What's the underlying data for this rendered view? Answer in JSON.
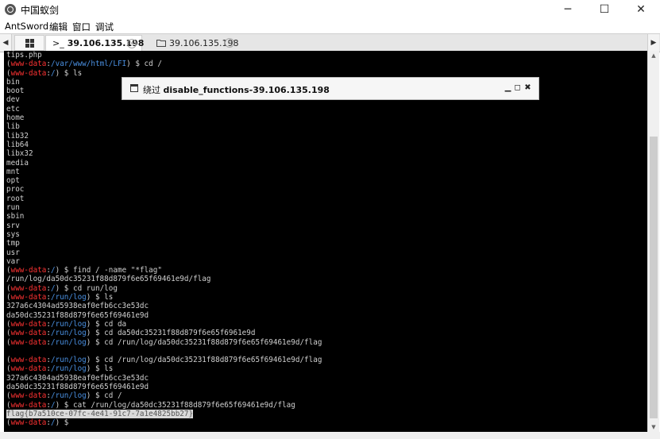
{
  "window": {
    "title": "中国蚁剑",
    "minimize": "─",
    "maximize": "☐",
    "close": "✕"
  },
  "menu": [
    "AntSword",
    "编辑",
    "窗口",
    "调试"
  ],
  "tabs": {
    "prev": "◀",
    "next": "▶",
    "active": {
      "prefix": ">_",
      "label": "39.106.135.198"
    },
    "inactive": {
      "label": "39.106.135.198"
    }
  },
  "dialog": {
    "prefix": "绕过",
    "title": "disable_functions-39.106.135.198",
    "minimize": "▁",
    "maximize": "◻",
    "close": "✖"
  },
  "terminal": {
    "lines": [
      {
        "t": "tips.php"
      },
      {
        "p": {
          "user": "www-data",
          "path": "/var/www/html/LFI"
        },
        "c": "cd /"
      },
      {
        "p": {
          "user": "www-data",
          "path": "/"
        },
        "c": "ls"
      },
      {
        "t": "bin"
      },
      {
        "t": "boot"
      },
      {
        "t": "dev"
      },
      {
        "t": "etc"
      },
      {
        "t": "home"
      },
      {
        "t": "lib"
      },
      {
        "t": "lib32"
      },
      {
        "t": "lib64"
      },
      {
        "t": "libx32"
      },
      {
        "t": "media"
      },
      {
        "t": "mnt"
      },
      {
        "t": "opt"
      },
      {
        "t": "proc"
      },
      {
        "t": "root"
      },
      {
        "t": "run"
      },
      {
        "t": "sbin"
      },
      {
        "t": "srv"
      },
      {
        "t": "sys"
      },
      {
        "t": "tmp"
      },
      {
        "t": "usr"
      },
      {
        "t": "var"
      },
      {
        "p": {
          "user": "www-data",
          "path": "/"
        },
        "c": "find / -name \"*flag\""
      },
      {
        "t": "/run/log/da50dc35231f88d879f6e65f69461e9d/flag"
      },
      {
        "p": {
          "user": "www-data",
          "path": "/"
        },
        "c": "cd run/log"
      },
      {
        "p": {
          "user": "www-data",
          "path": "/run/log"
        },
        "c": "ls"
      },
      {
        "t": "327a6c4304ad5938eaf0efb6cc3e53dc"
      },
      {
        "t": "da50dc35231f88d879f6e65f69461e9d"
      },
      {
        "p": {
          "user": "www-data",
          "path": "/run/log"
        },
        "c": "cd da"
      },
      {
        "p": {
          "user": "www-data",
          "path": "/run/log"
        },
        "c": "cd da50dc35231f88d879f6e65f6961e9d"
      },
      {
        "p": {
          "user": "www-data",
          "path": "/run/log"
        },
        "c": "cd /run/log/da50dc35231f88d879f6e65f69461e9d/flag"
      },
      {
        "t": ""
      },
      {
        "p": {
          "user": "www-data",
          "path": "/run/log"
        },
        "c": "cd /run/log/da50dc35231f88d879f6e65f69461e9d/flag"
      },
      {
        "p": {
          "user": "www-data",
          "path": "/run/log"
        },
        "c": "ls"
      },
      {
        "t": "327a6c4304ad5938eaf0efb6cc3e53dc"
      },
      {
        "t": "da50dc35231f88d879f6e65f69461e9d"
      },
      {
        "p": {
          "user": "www-data",
          "path": "/run/log"
        },
        "c": "cd /"
      },
      {
        "p": {
          "user": "www-data",
          "path": "/"
        },
        "c": "cat /run/log/da50dc35231f88d879f6e65f69461e9d/flag"
      },
      {
        "t": "flag{b7a510ce-07fc-4e41-91c7-7a1e4825bb27}",
        "selected": true
      },
      {
        "p": {
          "user": "www-data",
          "path": "/"
        },
        "c": ""
      }
    ]
  },
  "colors": {
    "prompt_user": "#ff3333",
    "prompt_path": "#4a90e2",
    "terminal_bg": "#000000",
    "terminal_fg": "#d0d0d0"
  }
}
